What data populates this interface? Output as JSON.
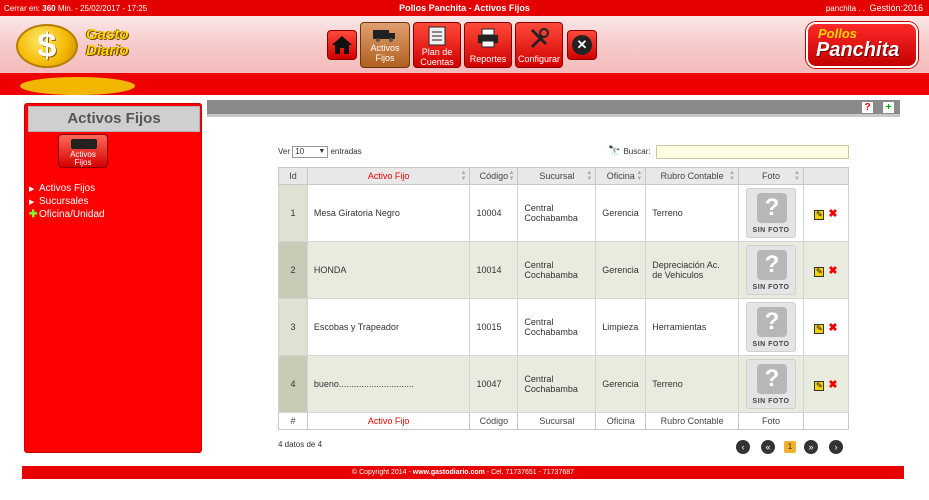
{
  "topbar": {
    "session_prefix": "Cerrar en:",
    "session_minutes": "360",
    "session_suffix": "Min. - 25/02/2017 - 17:25",
    "title": "Pollos Panchita - Activos Fijos",
    "user": "panchita . .",
    "gestion": "Gestión:2016"
  },
  "logo": {
    "line1": "Gasto",
    "line2": "Diario",
    "symbol": "$"
  },
  "nav": {
    "activos_line1": "Activos",
    "activos_line2": "Fijos",
    "plan_line1": "Plan de",
    "plan_line2": "Cuentas",
    "reportes": "Reportes",
    "configurar": "Configurar",
    "close_symbol": "✕"
  },
  "brand": {
    "line1": "Pollos",
    "line2": "Panchita"
  },
  "sidebar": {
    "title": "Activos Fijos",
    "icon_label_1": "Activos",
    "icon_label_2": "Fijos",
    "items": [
      {
        "label": "Activos Fijos"
      },
      {
        "label": "Sucursales"
      },
      {
        "label": "Oficina/Unidad"
      }
    ]
  },
  "toolbar": {
    "help_symbol": "?",
    "add_symbol": "+"
  },
  "controls": {
    "ver_label": "Ver",
    "ver_value": "10",
    "entradas_label": "entradas",
    "buscar_label": "Buscar:"
  },
  "table": {
    "headers": [
      "Id",
      "Activo Fijo",
      "Código",
      "Sucursal",
      "Oficina",
      "Rubro Contable",
      "Foto"
    ],
    "footers": [
      "#",
      "Activo Fijo",
      "Código",
      "Sucursal",
      "Oficina",
      "Rubro Contable",
      "Foto"
    ],
    "sin_foto": "SIN FOTO",
    "rows": [
      {
        "id": "1",
        "activo": "Mesa Giratoria Negro",
        "codigo": "10004",
        "sucursal_1": "Central",
        "sucursal_2": "Cochabamba",
        "oficina": "Gerencia",
        "rubro_1": "Terreno",
        "rubro_2": ""
      },
      {
        "id": "2",
        "activo": "HONDA",
        "codigo": "10014",
        "sucursal_1": "Central",
        "sucursal_2": "Cochabamba",
        "oficina": "Gerencia",
        "rubro_1": "Depreciación Ac.",
        "rubro_2": "de Vehiculos"
      },
      {
        "id": "3",
        "activo": "Escobas y Trapeador",
        "codigo": "10015",
        "sucursal_1": "Central",
        "sucursal_2": "Cochabamba",
        "oficina": "Limpieza",
        "rubro_1": "Herramientas",
        "rubro_2": ""
      },
      {
        "id": "4",
        "activo": "bueno..............................",
        "codigo": "10047",
        "sucursal_1": "Central",
        "sucursal_2": "Cochabamba",
        "oficina": "Gerencia",
        "rubro_1": "Terreno",
        "rubro_2": ""
      }
    ]
  },
  "info": "4 datos de 4",
  "pagination": {
    "current": "1"
  },
  "footer": {
    "copyright": "© Copyright 2014 - ",
    "site": "www.gastodiario.com",
    "phones": " - Cel. 71737651 - 71737687"
  }
}
